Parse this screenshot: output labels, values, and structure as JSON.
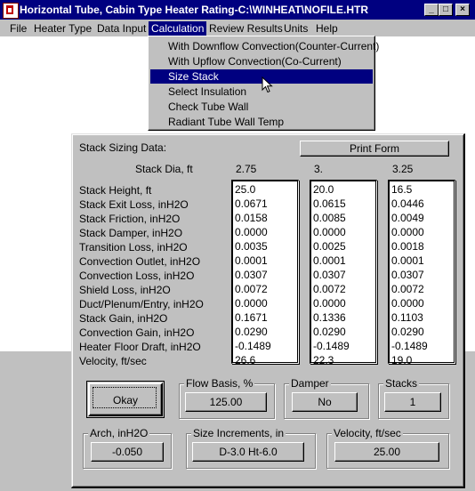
{
  "window": {
    "title": "Horizontal Tube, Cabin Type Heater Rating-C:\\WINHEAT\\NOFILE.HTR",
    "controls": [
      "_",
      "□",
      "×"
    ]
  },
  "menubar": [
    "File",
    "Heater Type",
    "Data Input",
    "Calculation",
    "Review Results",
    "Units",
    "Help"
  ],
  "calculation_menu": {
    "items": [
      "With Downflow Convection(Counter-Current)",
      "With Upflow Convection(Co-Current)",
      "Size Stack",
      "Select Insulation",
      "Check Tube Wall",
      "Radiant Tube Wall Temp"
    ],
    "highlighted": "Size Stack"
  },
  "dialog": {
    "header_label": "Stack Sizing Data:",
    "print_button": "Print Form",
    "stack_dia_label": "Stack Dia, ft",
    "diameters": [
      "2.75",
      "3.",
      "3.25"
    ],
    "row_labels": [
      "Stack Height, ft",
      "Stack Exit Loss, inH2O",
      "Stack Friction, inH2O",
      "Stack Damper, inH2O",
      "Transition Loss, inH2O",
      "Convection Outlet, inH2O",
      "Convection Loss, inH2O",
      "Shield Loss, inH2O",
      "Duct/Plenum/Entry, inH2O",
      "Stack Gain, inH2O",
      "Convection Gain, inH2O",
      "Heater Floor Draft, inH2O",
      "Velocity, ft/sec"
    ],
    "columns": [
      [
        "25.0",
        "0.0671",
        "0.0158",
        "0.0000",
        "0.0035",
        "0.0001",
        "0.0307",
        "0.0072",
        "0.0000",
        "0.1671",
        "0.0290",
        "-0.1489",
        "26.6"
      ],
      [
        "20.0",
        "0.0615",
        "0.0085",
        "0.0000",
        "0.0025",
        "0.0001",
        "0.0307",
        "0.0072",
        "0.0000",
        "0.1336",
        "0.0290",
        "-0.1489",
        "22.3"
      ],
      [
        "16.5",
        "0.0446",
        "0.0049",
        "0.0000",
        "0.0018",
        "0.0001",
        "0.0307",
        "0.0072",
        "0.0000",
        "0.1103",
        "0.0290",
        "-0.1489",
        "19.0"
      ]
    ],
    "okay_button": "Okay",
    "flow_basis": {
      "label": "Flow Basis, %",
      "value": "125.00"
    },
    "damper": {
      "label": "Damper",
      "value": "No"
    },
    "stacks": {
      "label": "Stacks",
      "value": "1"
    },
    "arch": {
      "label": "Arch, inH2O",
      "value": "-0.050"
    },
    "size_increments": {
      "label": "Size Increments, in",
      "value": "D-3.0 Ht-6.0"
    },
    "velocity": {
      "label": "Velocity, ft/sec",
      "value": "25.00"
    }
  },
  "colors": {
    "title_bar": "#000080",
    "face": "#c0c0c0",
    "highlight": "#000080"
  }
}
